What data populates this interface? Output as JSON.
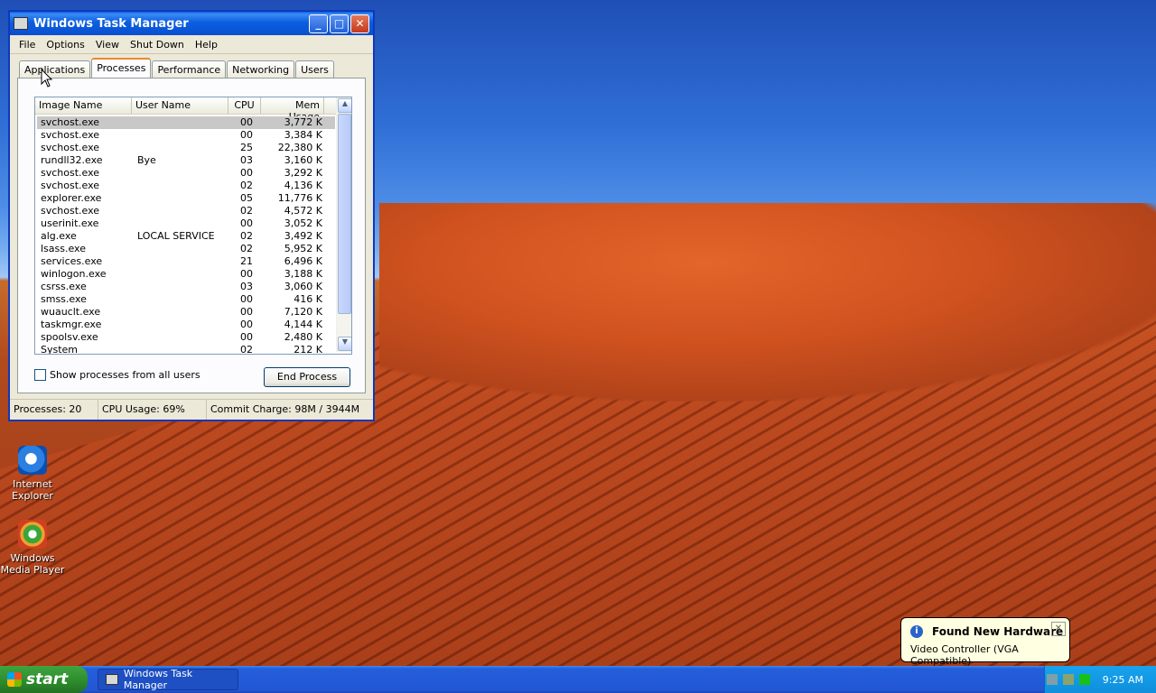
{
  "window": {
    "title": "Windows Task Manager",
    "menu": [
      "File",
      "Options",
      "View",
      "Shut Down",
      "Help"
    ],
    "tabs": [
      "Applications",
      "Processes",
      "Performance",
      "Networking",
      "Users"
    ],
    "active_tab": "Processes",
    "columns": [
      "Image Name",
      "User Name",
      "CPU",
      "Mem Usage"
    ],
    "processes": [
      {
        "name": "svchost.exe",
        "user": "",
        "cpu": "00",
        "mem": "3,772 K"
      },
      {
        "name": "svchost.exe",
        "user": "",
        "cpu": "00",
        "mem": "3,384 K"
      },
      {
        "name": "svchost.exe",
        "user": "",
        "cpu": "25",
        "mem": "22,380 K"
      },
      {
        "name": "rundll32.exe",
        "user": "Bye",
        "cpu": "03",
        "mem": "3,160 K"
      },
      {
        "name": "svchost.exe",
        "user": "",
        "cpu": "00",
        "mem": "3,292 K"
      },
      {
        "name": "svchost.exe",
        "user": "",
        "cpu": "02",
        "mem": "4,136 K"
      },
      {
        "name": "explorer.exe",
        "user": "",
        "cpu": "05",
        "mem": "11,776 K"
      },
      {
        "name": "svchost.exe",
        "user": "",
        "cpu": "02",
        "mem": "4,572 K"
      },
      {
        "name": "userinit.exe",
        "user": "",
        "cpu": "00",
        "mem": "3,052 K"
      },
      {
        "name": "alg.exe",
        "user": "LOCAL SERVICE",
        "cpu": "02",
        "mem": "3,492 K"
      },
      {
        "name": "lsass.exe",
        "user": "",
        "cpu": "02",
        "mem": "5,952 K"
      },
      {
        "name": "services.exe",
        "user": "",
        "cpu": "21",
        "mem": "6,496 K"
      },
      {
        "name": "winlogon.exe",
        "user": "",
        "cpu": "00",
        "mem": "3,188 K"
      },
      {
        "name": "csrss.exe",
        "user": "",
        "cpu": "03",
        "mem": "3,060 K"
      },
      {
        "name": "smss.exe",
        "user": "",
        "cpu": "00",
        "mem": "416 K"
      },
      {
        "name": "wuauclt.exe",
        "user": "",
        "cpu": "00",
        "mem": "7,120 K"
      },
      {
        "name": "taskmgr.exe",
        "user": "",
        "cpu": "00",
        "mem": "4,144 K"
      },
      {
        "name": "spoolsv.exe",
        "user": "",
        "cpu": "00",
        "mem": "2,480 K"
      },
      {
        "name": "System",
        "user": "",
        "cpu": "02",
        "mem": "212 K"
      }
    ],
    "show_all_label": "Show processes from all users",
    "end_process_label": "End Process",
    "status": {
      "processes": "Processes: 20",
      "cpu": "CPU Usage: 69%",
      "commit": "Commit Charge: 98M / 3944M"
    }
  },
  "desktop": {
    "icons": [
      "Internet Explorer",
      "Windows Media Player"
    ]
  },
  "balloon": {
    "title": "Found New Hardware",
    "text": "Video Controller (VGA Compatible)"
  },
  "taskbar": {
    "start_label": "start",
    "task_button": "Windows Task Manager",
    "clock": "9:25 AM"
  }
}
